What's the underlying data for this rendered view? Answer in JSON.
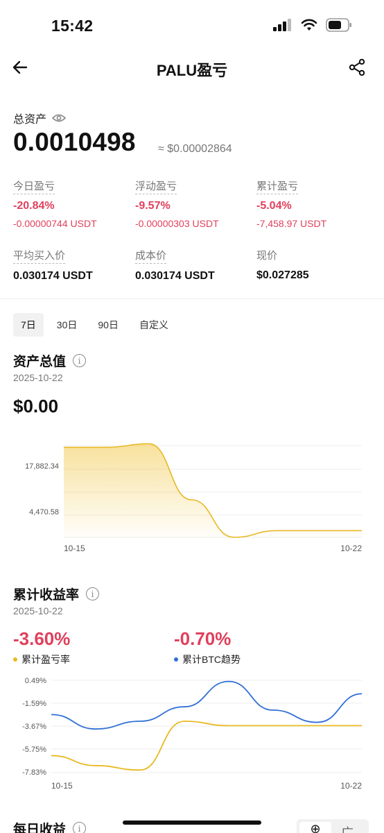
{
  "status_bar": {
    "time": "15:42"
  },
  "header": {
    "title": "PALU盈亏"
  },
  "summary": {
    "total_label": "总资产",
    "total_value": "0.0010498",
    "total_approx": "≈ $0.00002864",
    "stats": [
      {
        "label": "今日盈亏",
        "pct": "-20.84%",
        "amount": "-0.00000744 USDT"
      },
      {
        "label": "浮动盈亏",
        "pct": "-9.57%",
        "amount": "-0.00000303 USDT"
      },
      {
        "label": "累计盈亏",
        "pct": "-5.04%",
        "amount": "-7,458.97 USDT"
      }
    ],
    "prices": [
      {
        "label": "平均买入价",
        "value": "0.030174 USDT"
      },
      {
        "label": "成本价",
        "value": "0.030174 USDT"
      },
      {
        "label": "现价",
        "value": "$0.027285"
      }
    ]
  },
  "periods": {
    "items": [
      "7日",
      "30日",
      "90日",
      "自定义"
    ],
    "active": "7日"
  },
  "asset_section": {
    "title": "资产总值",
    "date": "2025-10-22",
    "value": "$0.00"
  },
  "return_section": {
    "title": "累计收益率",
    "date": "2025-10-22",
    "pnl_value": "-3.60%",
    "pnl_label": "累计盈亏率",
    "btc_value": "-0.70%",
    "btc_label": "累计BTC趋势"
  },
  "daily_section": {
    "title": "每日收益",
    "toggle_a": "⊕",
    "toggle_b": "广"
  },
  "colors": {
    "loss": "#e0405c",
    "pnl_line": "#e8b923",
    "btc_line": "#2f6fd6"
  },
  "chart_data": [
    {
      "type": "area",
      "x": [
        "10-15",
        "10-16",
        "10-17",
        "10-18",
        "10-19",
        "10-20",
        "10-21",
        "10-22"
      ],
      "series": [
        {
          "values": [
            20400,
            20400,
            21200,
            8500,
            0,
            1500,
            1500,
            1500
          ]
        }
      ],
      "y_ticks": [
        "17,882.34",
        "4,470.58"
      ],
      "x_ticks": [
        "10-15",
        "10-22"
      ],
      "ylim": [
        0,
        22353
      ],
      "grid": true
    },
    {
      "type": "line",
      "x": [
        "10-15",
        "10-16",
        "10-17",
        "10-18",
        "10-19",
        "10-20",
        "10-21",
        "10-22"
      ],
      "series": [
        {
          "name": "累计盈亏率",
          "values": [
            -6.3,
            -7.2,
            -7.6,
            -3.2,
            -3.6,
            -3.6,
            -3.6,
            -3.6
          ]
        },
        {
          "name": "累计BTC趋势",
          "values": [
            -2.6,
            -3.9,
            -3.2,
            -1.9,
            0.39,
            -2.2,
            -3.3,
            -0.72
          ]
        }
      ],
      "y_ticks": [
        "0.49%",
        "-1.59%",
        "-3.67%",
        "-5.75%",
        "-7.83%"
      ],
      "x_ticks": [
        "10-15",
        "10-22"
      ],
      "ylim": [
        -7.83,
        0.49
      ],
      "grid": true
    }
  ]
}
